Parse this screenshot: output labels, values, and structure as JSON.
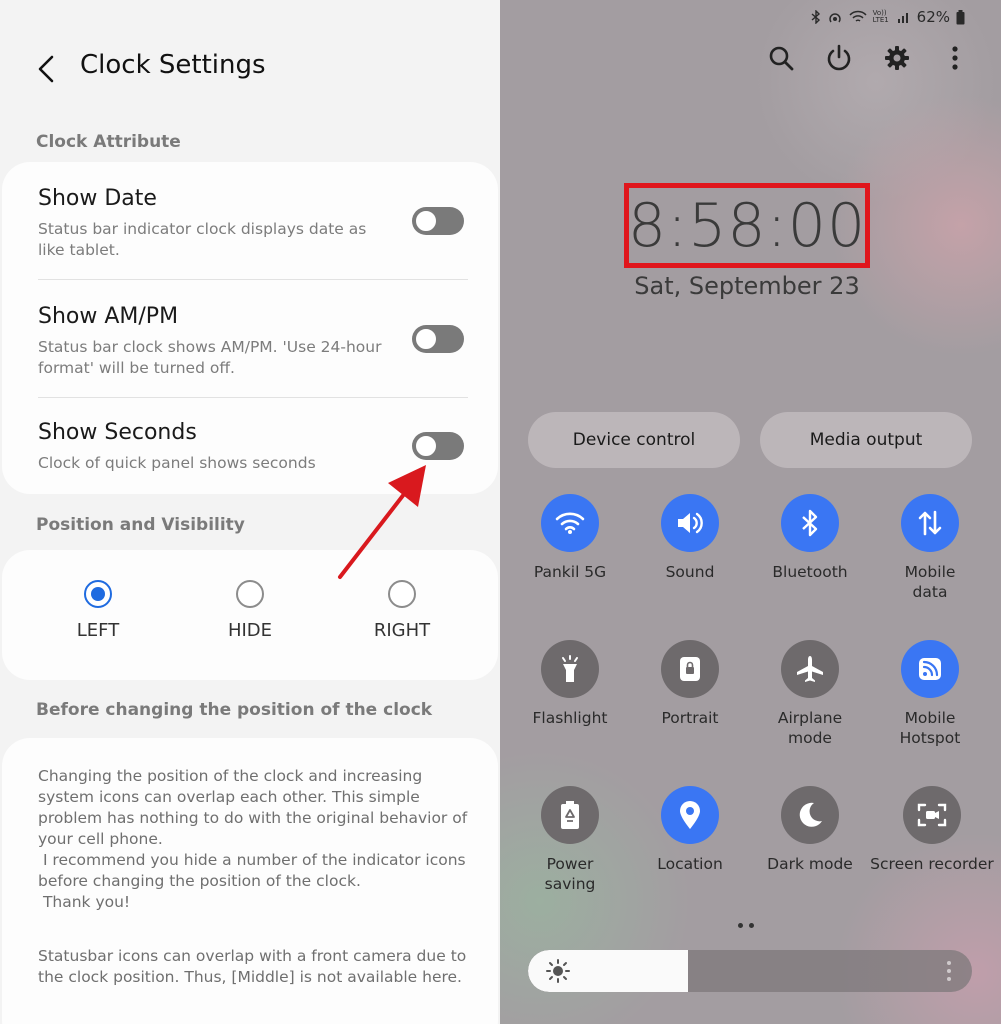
{
  "settings": {
    "title": "Clock Settings",
    "section_clock": "Clock Attribute",
    "show_date": {
      "title": "Show Date",
      "subtitle": "Status bar indicator clock displays date as like tablet.",
      "on": false
    },
    "show_ampm": {
      "title": "Show AM/PM",
      "subtitle": "Status bar clock shows AM/PM. 'Use 24-hour format' will be turned off.",
      "on": false
    },
    "show_seconds": {
      "title": "Show Seconds",
      "subtitle": "Clock of quick panel shows seconds",
      "on": false
    },
    "section_position": "Position and Visibility",
    "position_options": [
      {
        "label": "LEFT",
        "selected": true
      },
      {
        "label": "HIDE",
        "selected": false
      },
      {
        "label": "RIGHT",
        "selected": false
      }
    ],
    "section_before": "Before changing the position of the clock",
    "note1": "Changing the position of the clock and increasing system icons can overlap each other. This simple problem has nothing to do with the original behavior of your cell phone.\n I recommend you hide a number of the indicator icons before changing the position of the clock.\n Thank you!",
    "note2": "Statusbar icons can overlap with a front camera due to the clock position. Thus, [Middle] is not available here."
  },
  "quick_panel": {
    "battery": "62%",
    "network_badge": "Vo)) LTE1",
    "clock": "8:58:00",
    "date": "Sat, September 23",
    "device_control": "Device control",
    "media_output": "Media output",
    "tiles": [
      {
        "label": "Pankil 5G",
        "icon": "wifi-icon",
        "on": true
      },
      {
        "label": "Sound",
        "icon": "sound-icon",
        "on": true
      },
      {
        "label": "Bluetooth",
        "icon": "bluetooth-icon",
        "on": true
      },
      {
        "label": "Mobile\ndata",
        "icon": "mobile-data-icon",
        "on": true
      },
      {
        "label": "Flashlight",
        "icon": "flashlight-icon",
        "on": false
      },
      {
        "label": "Portrait",
        "icon": "portrait-lock-icon",
        "on": false
      },
      {
        "label": "Airplane\nmode",
        "icon": "airplane-icon",
        "on": false
      },
      {
        "label": "Mobile\nHotspot",
        "icon": "hotspot-icon",
        "on": true
      },
      {
        "label": "Power\nsaving",
        "icon": "power-saving-icon",
        "on": false
      },
      {
        "label": "Location",
        "icon": "location-icon",
        "on": true
      },
      {
        "label": "Dark mode",
        "icon": "dark-mode-icon",
        "on": false
      },
      {
        "label": "Screen recorder",
        "icon": "screen-recorder-icon",
        "on": false
      }
    ],
    "brightness": 0.36
  },
  "colors": {
    "accent": "#3a76f3",
    "radio": "#1f6be0",
    "highlight": "#e0161c",
    "arrow": "#d9191e"
  }
}
